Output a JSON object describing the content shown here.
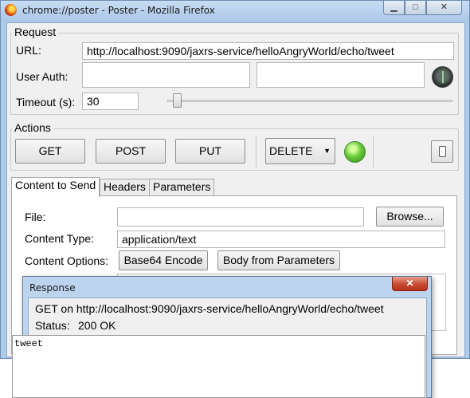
{
  "window": {
    "title": "chrome://poster - Poster - Mozilla Firefox",
    "minimize_glyph": "▁",
    "maximize_glyph": "□",
    "close_glyph": "✕"
  },
  "request": {
    "group_title": "Request",
    "url_label": "URL:",
    "url_value": "http://localhost:9090/jaxrs-service/helloAngryWorld/echo/tweet",
    "user_auth_label": "User Auth:",
    "user_value": "",
    "password_value": "",
    "timeout_label": "Timeout (s):",
    "timeout_value": "30",
    "timeout_slider_fraction": 0.02
  },
  "actions": {
    "group_title": "Actions",
    "get_label": "GET",
    "post_label": "POST",
    "put_label": "PUT",
    "method_select_value": "DELETE",
    "status_color": "#5cc43a"
  },
  "tabs": [
    {
      "label": "Content to Send",
      "active": true
    },
    {
      "label": "Headers",
      "active": false
    },
    {
      "label": "Parameters",
      "active": false
    }
  ],
  "content": {
    "file_label": "File:",
    "file_value": "",
    "browse_label": "Browse...",
    "content_type_label": "Content Type:",
    "content_type_value": "application/text",
    "content_options_label": "Content Options:",
    "base64_label": "Base64 Encode",
    "body_from_params_label": "Body from Parameters"
  },
  "response": {
    "title": "Response",
    "close_glyph": "✕",
    "summary": "GET on http://localhost:9090/jaxrs-service/helloAngryWorld/echo/tweet",
    "status_label": "Status:",
    "status_value": "200 OK",
    "body": "tweet"
  }
}
